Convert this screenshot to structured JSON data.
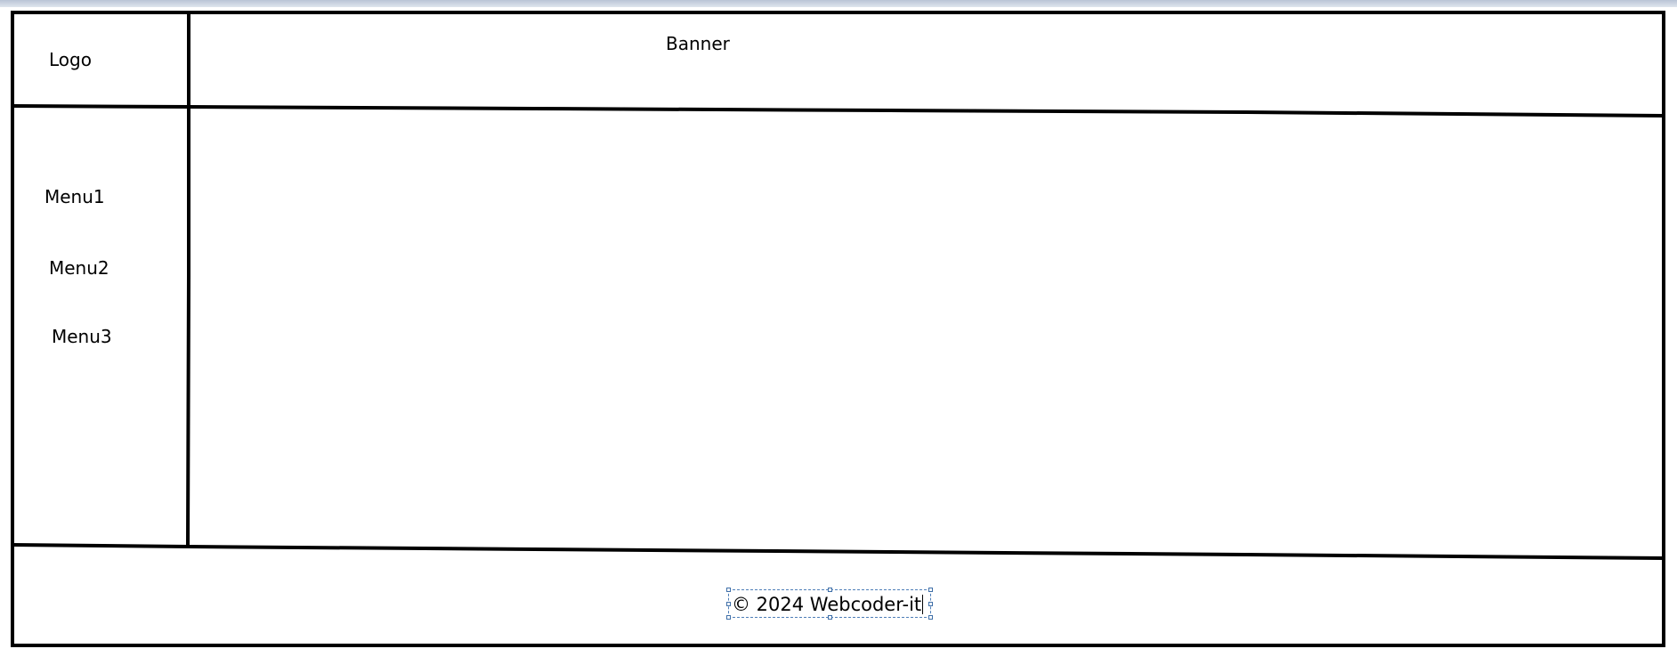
{
  "layout_diagram": {
    "logo_label": "Logo",
    "banner_label": "Banner",
    "menu_items": [
      {
        "label": "Menu1"
      },
      {
        "label": "Menu2"
      },
      {
        "label": "Menu3"
      }
    ],
    "footer_text": "© 2024 Webcoder-it"
  }
}
